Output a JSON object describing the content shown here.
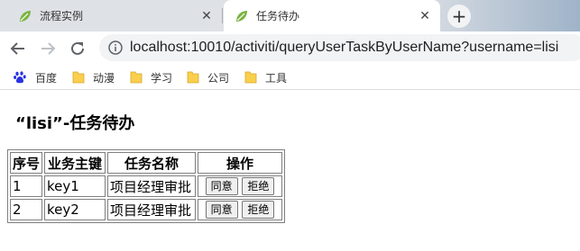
{
  "tabs": [
    {
      "title": "流程实例",
      "active": false
    },
    {
      "title": "任务待办",
      "active": true
    }
  ],
  "address_bar": {
    "url": "localhost:10010/activiti/queryUserTaskByUserName?username=lisi"
  },
  "bookmarks": [
    {
      "label": "百度",
      "icon": "baidu-paw-icon"
    },
    {
      "label": "动漫",
      "icon": "folder-icon"
    },
    {
      "label": "学习",
      "icon": "folder-icon"
    },
    {
      "label": "公司",
      "icon": "folder-icon"
    },
    {
      "label": "工具",
      "icon": "folder-icon"
    }
  ],
  "page": {
    "title": "“lisi”-任务待办",
    "table": {
      "headers": [
        "序号",
        "业务主键",
        "任务名称",
        "操作"
      ],
      "rows": [
        {
          "index": "1",
          "business_key": "key1",
          "task_name": "项目经理审批",
          "approve": "同意",
          "reject": "拒绝"
        },
        {
          "index": "2",
          "business_key": "key2",
          "task_name": "项目经理审批",
          "approve": "同意",
          "reject": "拒绝"
        }
      ]
    }
  },
  "colors": {
    "tab_strip": "#dee1e6",
    "omnibox": "#f1f3f4",
    "favicon_green": "#7cb342",
    "folder_yellow": "#f9cf4d"
  }
}
